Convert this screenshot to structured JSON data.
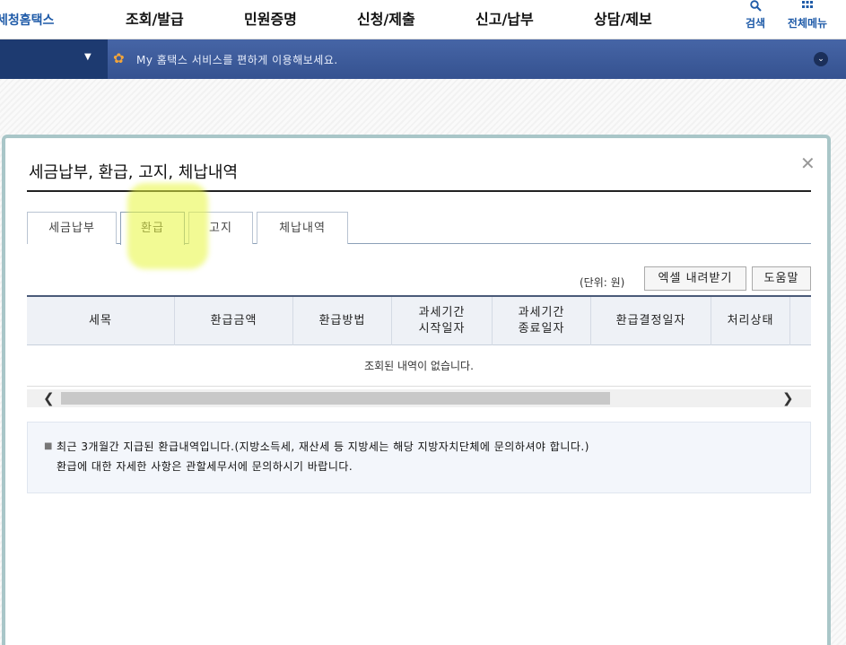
{
  "header": {
    "logo": "세청홈택스",
    "nav": [
      "조회/발급",
      "민원증명",
      "신청/제출",
      "신고/납부",
      "상담/제보"
    ],
    "search_label": "검색",
    "all_menu_label": "전체메뉴"
  },
  "bluebar": {
    "message": "My 홈택스 서비스를 편하게 이용해보세요."
  },
  "modal": {
    "title": "세금납부, 환급, 고지, 체납내역",
    "tabs": [
      {
        "label": "세금납부",
        "active": false
      },
      {
        "label": "환급",
        "active": true
      },
      {
        "label": "고지",
        "active": false
      },
      {
        "label": "체납내역",
        "active": false
      }
    ],
    "unit": "(단위: 원)",
    "excel_button": "엑셀 내려받기",
    "help_button": "도움말",
    "table": {
      "headers": [
        "세목",
        "환급금액",
        "환급방법",
        "과세기간\n시작일자",
        "과세기간\n종료일자",
        "환급결정일자",
        "처리상태"
      ],
      "empty_message": "조회된 내역이 없습니다."
    },
    "notice": {
      "line1": "최근 3개월간 지급된 환급내역입니다.(지방소득세, 재산세 등 지방세는 해당 지방자치단체에 문의하셔야 합니다.)",
      "line2": "환급에 대한 자세한 사항은 관할세무서에 문의하시기 바랍니다."
    }
  },
  "colors": {
    "brand": "#1f5ba8",
    "bluebar": "#3b5998",
    "highlight": "#e8f53c"
  }
}
